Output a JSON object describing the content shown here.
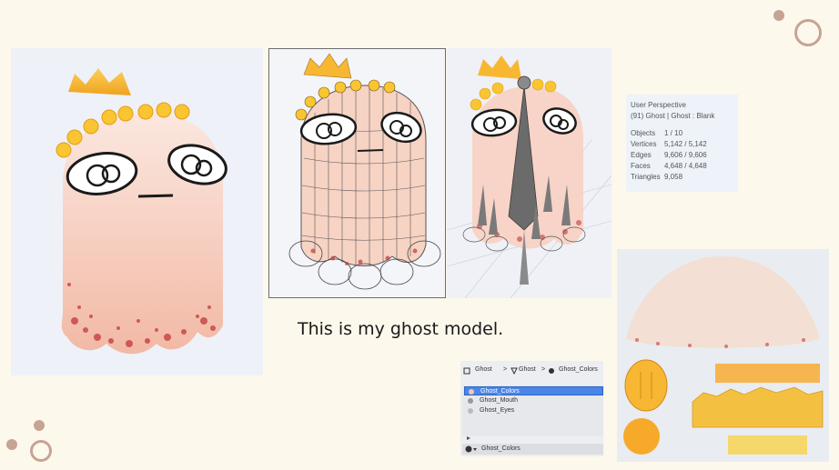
{
  "caption": "This is my ghost model.",
  "colors": {
    "background": "#fdf8ec",
    "decoration": "#c7a394",
    "ghost_body": "#f6c6b4",
    "crown": "#f7b733",
    "flowers": "#f9c531",
    "blood_spots": "#c0393b",
    "selection": "#4a86e8"
  },
  "stats_overlay": {
    "view": "User Perspective",
    "object_info": "(91) Ghost | Ghost : Blank",
    "rows": [
      {
        "label": "Objects",
        "value": "1 / 10"
      },
      {
        "label": "Vertices",
        "value": "5,142 / 5,142"
      },
      {
        "label": "Edges",
        "value": "9,606 / 9,606"
      },
      {
        "label": "Faces",
        "value": "4,648 / 4,648"
      },
      {
        "label": "Triangles",
        "value": "9,058"
      }
    ]
  },
  "materials_panel": {
    "breadcrumb": [
      "Ghost",
      "Ghost",
      "Ghost_Colors"
    ],
    "icons": [
      "object-icon",
      "mesh-icon",
      "material-icon"
    ],
    "materials": [
      {
        "name": "Ghost_Colors",
        "selected": true
      },
      {
        "name": "Ghost_Mouth",
        "selected": false
      },
      {
        "name": "Ghost_Eyes",
        "selected": false
      }
    ],
    "active_material": "Ghost_Colors"
  }
}
